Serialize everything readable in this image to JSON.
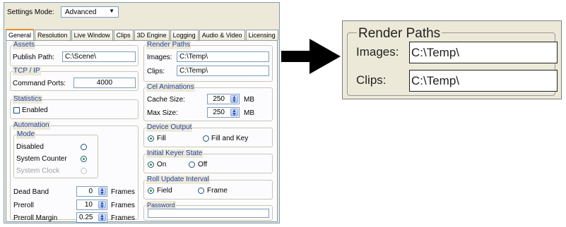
{
  "settings_mode": {
    "label": "Settings Mode:",
    "value": "Advanced"
  },
  "tabs": [
    "General",
    "Resolution",
    "Live Window",
    "Clips",
    "3D Engine",
    "Logging",
    "Audio & Video",
    "Licensing"
  ],
  "selected_tab": "General",
  "assets": {
    "title": "Assets",
    "publish_label": "Publish Path:",
    "publish_value": "C:\\Scene\\"
  },
  "tcp": {
    "title": "TCP / IP",
    "ports_label": "Command Ports:",
    "ports_value": "4000"
  },
  "statistics": {
    "title": "Statistics",
    "enabled_label": "Enabled",
    "enabled": false
  },
  "automation": {
    "title": "Automation",
    "mode_title": "Mode",
    "modes": [
      {
        "label": "Disabled",
        "selected": false,
        "disabled": false
      },
      {
        "label": "System Counter",
        "selected": true,
        "disabled": false
      },
      {
        "label": "System Clock",
        "selected": false,
        "disabled": true
      }
    ],
    "dead_band": {
      "label": "Dead Band",
      "value": "0",
      "unit": "Frames"
    },
    "preroll": {
      "label": "Preroll",
      "value": "10",
      "unit": "Frames"
    },
    "preroll_margin": {
      "label": "Preroll Margin",
      "value": "0.25",
      "unit": "Frames"
    }
  },
  "render_paths": {
    "title": "Render Paths",
    "images_label": "Images:",
    "images_value": "C:\\Temp\\",
    "clips_label": "Clips:",
    "clips_value": "C:\\Temp\\"
  },
  "cel_animations": {
    "title": "Cel Animations",
    "cache_label": "Cache Size:",
    "cache_value": "250",
    "cache_unit": "MB",
    "max_label": "Max Size:",
    "max_value": "250",
    "max_unit": "MB"
  },
  "device_output": {
    "title": "Device Output",
    "options": [
      {
        "label": "Fill",
        "selected": true
      },
      {
        "label": "Fill and Key",
        "selected": false
      }
    ]
  },
  "initial_keyer": {
    "title": "Initial Keyer State",
    "options": [
      {
        "label": "On",
        "selected": true
      },
      {
        "label": "Off",
        "selected": false
      }
    ]
  },
  "roll_update": {
    "title": "Roll Update Interval",
    "options": [
      {
        "label": "Field",
        "selected": true
      },
      {
        "label": "Frame",
        "selected": false
      }
    ]
  },
  "password": {
    "title": "Password",
    "value": ""
  },
  "zoom_callout": {
    "title": "Render Paths",
    "images_label": "Images:",
    "images_value": "C:\\Temp\\",
    "clips_label": "Clips:",
    "clips_value": "C:\\Temp\\"
  },
  "colors": {
    "group_title": "#1f3f9d",
    "panel_bg": "#ece9d8",
    "tab_highlight": "#e68b2c",
    "arrow": "#000000"
  },
  "icons": [
    "dropdown-arrow-icon",
    "spin-arrows-icon",
    "callout-arrow-icon"
  ]
}
